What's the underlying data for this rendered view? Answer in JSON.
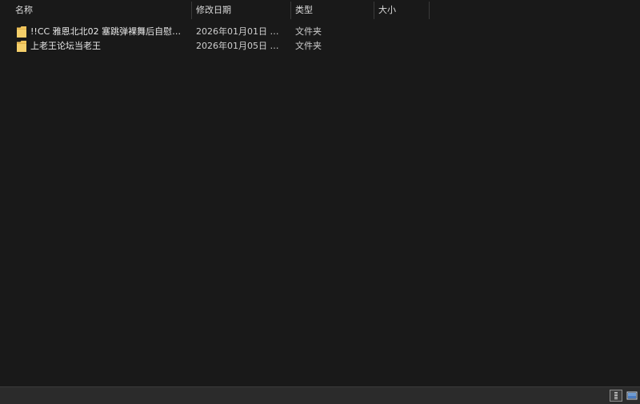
{
  "columns": {
    "name": "名称",
    "date_modified": "修改日期",
    "type": "类型",
    "size": "大小"
  },
  "files": [
    {
      "icon": "folder-icon",
      "name": "!!CC 雅恩北北02 塞跳弹裸舞后自慰喷水...",
      "date_modified": "2026年01月01日 星期...",
      "type": "文件夹",
      "size": ""
    },
    {
      "icon": "folder-icon",
      "name": "上老王论坛当老王",
      "date_modified": "2026年01月05日 星期...",
      "type": "文件夹",
      "size": ""
    }
  ],
  "statusbar": {
    "view_buttons": [
      "details-view-icon",
      "large-icons-view-icon"
    ]
  },
  "colors": {
    "background": "#191919",
    "folder": "#f2c55c",
    "statusbar": "#2b2b2b"
  }
}
